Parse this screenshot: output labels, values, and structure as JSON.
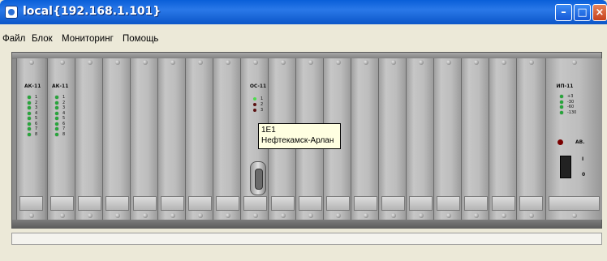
{
  "window": {
    "title": "local{192.168.1.101}"
  },
  "menu": {
    "items": [
      "Файл",
      "Блок",
      "Мониторинг",
      "Помощь"
    ]
  },
  "rack": {
    "cards": [
      {
        "name": "АК-11",
        "leds": [
          "1",
          "2",
          "3",
          "4",
          "5",
          "6",
          "7",
          "8"
        ]
      },
      {
        "name": "АК-11",
        "leds": [
          "1",
          "2",
          "3",
          "4",
          "5",
          "6",
          "7",
          "8"
        ]
      },
      {
        "name": "ОС-11",
        "leds": [
          "1",
          "2",
          "3"
        ]
      },
      {
        "name": "ИП-11",
        "leds": [
          "+3",
          "-30",
          "-60",
          "-130"
        ],
        "alarm_label": "АВ.",
        "switch_on": "I",
        "switch_off": "0"
      }
    ]
  },
  "tooltip": {
    "line1": "1E1",
    "line2": "Нефтекамск-Арлан"
  }
}
